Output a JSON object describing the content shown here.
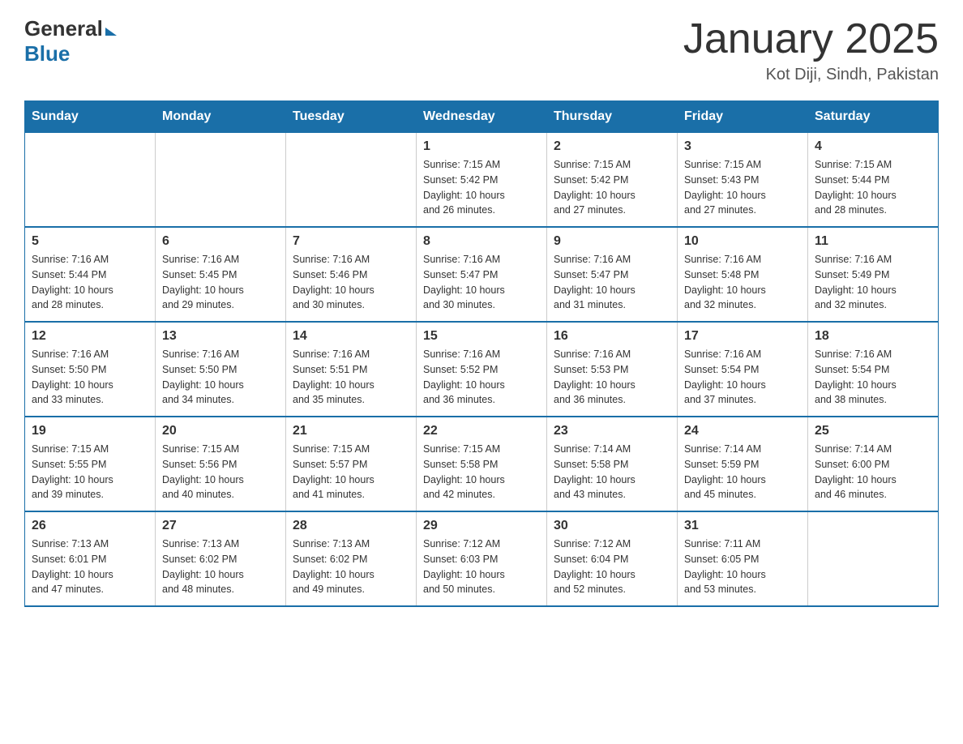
{
  "header": {
    "logo": {
      "general": "General",
      "blue": "Blue",
      "arrow": "▶"
    },
    "title": "January 2025",
    "location": "Kot Diji, Sindh, Pakistan"
  },
  "columns": [
    "Sunday",
    "Monday",
    "Tuesday",
    "Wednesday",
    "Thursday",
    "Friday",
    "Saturday"
  ],
  "weeks": [
    {
      "days": [
        {
          "number": "",
          "info": ""
        },
        {
          "number": "",
          "info": ""
        },
        {
          "number": "",
          "info": ""
        },
        {
          "number": "1",
          "info": "Sunrise: 7:15 AM\nSunset: 5:42 PM\nDaylight: 10 hours\nand 26 minutes."
        },
        {
          "number": "2",
          "info": "Sunrise: 7:15 AM\nSunset: 5:42 PM\nDaylight: 10 hours\nand 27 minutes."
        },
        {
          "number": "3",
          "info": "Sunrise: 7:15 AM\nSunset: 5:43 PM\nDaylight: 10 hours\nand 27 minutes."
        },
        {
          "number": "4",
          "info": "Sunrise: 7:15 AM\nSunset: 5:44 PM\nDaylight: 10 hours\nand 28 minutes."
        }
      ]
    },
    {
      "days": [
        {
          "number": "5",
          "info": "Sunrise: 7:16 AM\nSunset: 5:44 PM\nDaylight: 10 hours\nand 28 minutes."
        },
        {
          "number": "6",
          "info": "Sunrise: 7:16 AM\nSunset: 5:45 PM\nDaylight: 10 hours\nand 29 minutes."
        },
        {
          "number": "7",
          "info": "Sunrise: 7:16 AM\nSunset: 5:46 PM\nDaylight: 10 hours\nand 30 minutes."
        },
        {
          "number": "8",
          "info": "Sunrise: 7:16 AM\nSunset: 5:47 PM\nDaylight: 10 hours\nand 30 minutes."
        },
        {
          "number": "9",
          "info": "Sunrise: 7:16 AM\nSunset: 5:47 PM\nDaylight: 10 hours\nand 31 minutes."
        },
        {
          "number": "10",
          "info": "Sunrise: 7:16 AM\nSunset: 5:48 PM\nDaylight: 10 hours\nand 32 minutes."
        },
        {
          "number": "11",
          "info": "Sunrise: 7:16 AM\nSunset: 5:49 PM\nDaylight: 10 hours\nand 32 minutes."
        }
      ]
    },
    {
      "days": [
        {
          "number": "12",
          "info": "Sunrise: 7:16 AM\nSunset: 5:50 PM\nDaylight: 10 hours\nand 33 minutes."
        },
        {
          "number": "13",
          "info": "Sunrise: 7:16 AM\nSunset: 5:50 PM\nDaylight: 10 hours\nand 34 minutes."
        },
        {
          "number": "14",
          "info": "Sunrise: 7:16 AM\nSunset: 5:51 PM\nDaylight: 10 hours\nand 35 minutes."
        },
        {
          "number": "15",
          "info": "Sunrise: 7:16 AM\nSunset: 5:52 PM\nDaylight: 10 hours\nand 36 minutes."
        },
        {
          "number": "16",
          "info": "Sunrise: 7:16 AM\nSunset: 5:53 PM\nDaylight: 10 hours\nand 36 minutes."
        },
        {
          "number": "17",
          "info": "Sunrise: 7:16 AM\nSunset: 5:54 PM\nDaylight: 10 hours\nand 37 minutes."
        },
        {
          "number": "18",
          "info": "Sunrise: 7:16 AM\nSunset: 5:54 PM\nDaylight: 10 hours\nand 38 minutes."
        }
      ]
    },
    {
      "days": [
        {
          "number": "19",
          "info": "Sunrise: 7:15 AM\nSunset: 5:55 PM\nDaylight: 10 hours\nand 39 minutes."
        },
        {
          "number": "20",
          "info": "Sunrise: 7:15 AM\nSunset: 5:56 PM\nDaylight: 10 hours\nand 40 minutes."
        },
        {
          "number": "21",
          "info": "Sunrise: 7:15 AM\nSunset: 5:57 PM\nDaylight: 10 hours\nand 41 minutes."
        },
        {
          "number": "22",
          "info": "Sunrise: 7:15 AM\nSunset: 5:58 PM\nDaylight: 10 hours\nand 42 minutes."
        },
        {
          "number": "23",
          "info": "Sunrise: 7:14 AM\nSunset: 5:58 PM\nDaylight: 10 hours\nand 43 minutes."
        },
        {
          "number": "24",
          "info": "Sunrise: 7:14 AM\nSunset: 5:59 PM\nDaylight: 10 hours\nand 45 minutes."
        },
        {
          "number": "25",
          "info": "Sunrise: 7:14 AM\nSunset: 6:00 PM\nDaylight: 10 hours\nand 46 minutes."
        }
      ]
    },
    {
      "days": [
        {
          "number": "26",
          "info": "Sunrise: 7:13 AM\nSunset: 6:01 PM\nDaylight: 10 hours\nand 47 minutes."
        },
        {
          "number": "27",
          "info": "Sunrise: 7:13 AM\nSunset: 6:02 PM\nDaylight: 10 hours\nand 48 minutes."
        },
        {
          "number": "28",
          "info": "Sunrise: 7:13 AM\nSunset: 6:02 PM\nDaylight: 10 hours\nand 49 minutes."
        },
        {
          "number": "29",
          "info": "Sunrise: 7:12 AM\nSunset: 6:03 PM\nDaylight: 10 hours\nand 50 minutes."
        },
        {
          "number": "30",
          "info": "Sunrise: 7:12 AM\nSunset: 6:04 PM\nDaylight: 10 hours\nand 52 minutes."
        },
        {
          "number": "31",
          "info": "Sunrise: 7:11 AM\nSunset: 6:05 PM\nDaylight: 10 hours\nand 53 minutes."
        },
        {
          "number": "",
          "info": ""
        }
      ]
    }
  ]
}
